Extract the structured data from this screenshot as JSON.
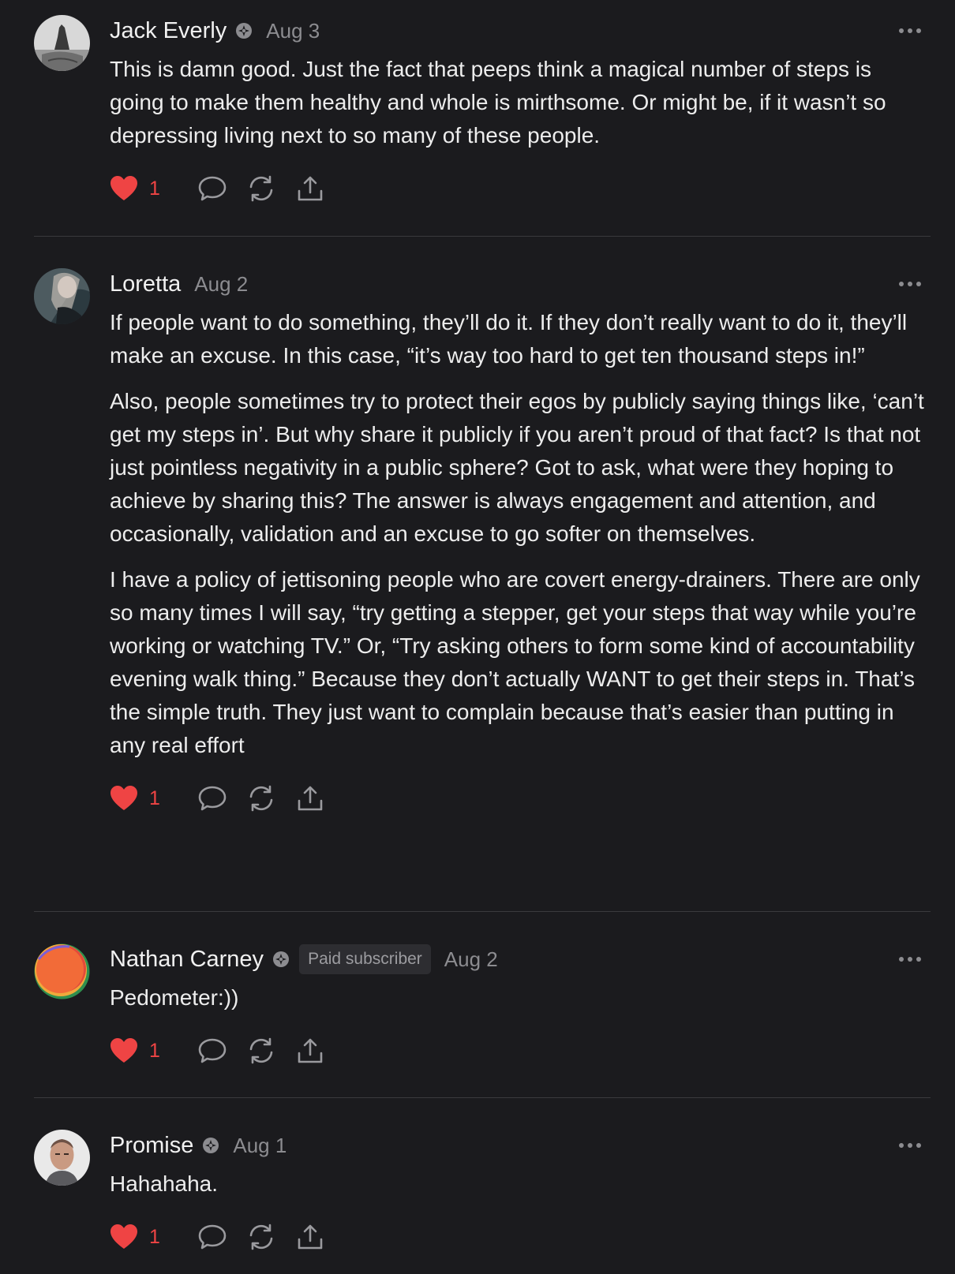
{
  "comments": [
    {
      "author": "Jack Everly",
      "verified": true,
      "date": "Aug 3",
      "paragraphs": [
        "This is damn good. Just the fact that peeps think a magical number of steps is going to make them healthy and whole is mirthsome. Or might be, if it wasn’t so depressing living next to so many of these people."
      ],
      "likes": "1"
    },
    {
      "author": "Loretta",
      "verified": false,
      "date": "Aug 2",
      "paragraphs": [
        "If people want to do something, they’ll do it. If they don’t really want to do it, they’ll make an excuse. In this case, “it’s way too hard to get ten thousand steps in!”",
        "Also, people sometimes try to protect their egos by publicly saying things like, ‘can’t get my steps in’. But why share it publicly if you aren’t proud of that fact? Is that not just pointless negativity in a public sphere? Got to ask, what were they hoping to achieve by sharing this? The answer is always engagement and attention, and occasionally, validation and an excuse to go softer on themselves.",
        "I have a policy of jettisoning people who are covert energy-drainers. There are only so many times I will say, “try getting a stepper, get your steps that way while you’re working or watching TV.” Or, “Try asking others to form some kind of accountability evening walk thing.” Because they don’t actually WANT to get their steps in. That’s the simple truth. They just want to complain because that’s easier than putting in any real effort"
      ],
      "likes": "1"
    },
    {
      "author": "Nathan Carney",
      "verified": true,
      "badge": "Paid subscriber",
      "date": "Aug 2",
      "paragraphs": [
        "Pedometer:))"
      ],
      "likes": "1"
    },
    {
      "author": "Promise",
      "verified": true,
      "date": "Aug 1",
      "paragraphs": [
        "Hahahaha."
      ],
      "likes": "1"
    }
  ],
  "icons": {
    "like": "heart-icon",
    "reply": "speech-bubble-icon",
    "restack": "restack-icon",
    "share": "share-icon",
    "more": "ellipsis-icon",
    "verified": "verified-badge-icon"
  },
  "colors": {
    "background": "#1b1b1e",
    "like_red": "#ef4444",
    "muted": "#8c8c90",
    "text": "#ededed"
  }
}
